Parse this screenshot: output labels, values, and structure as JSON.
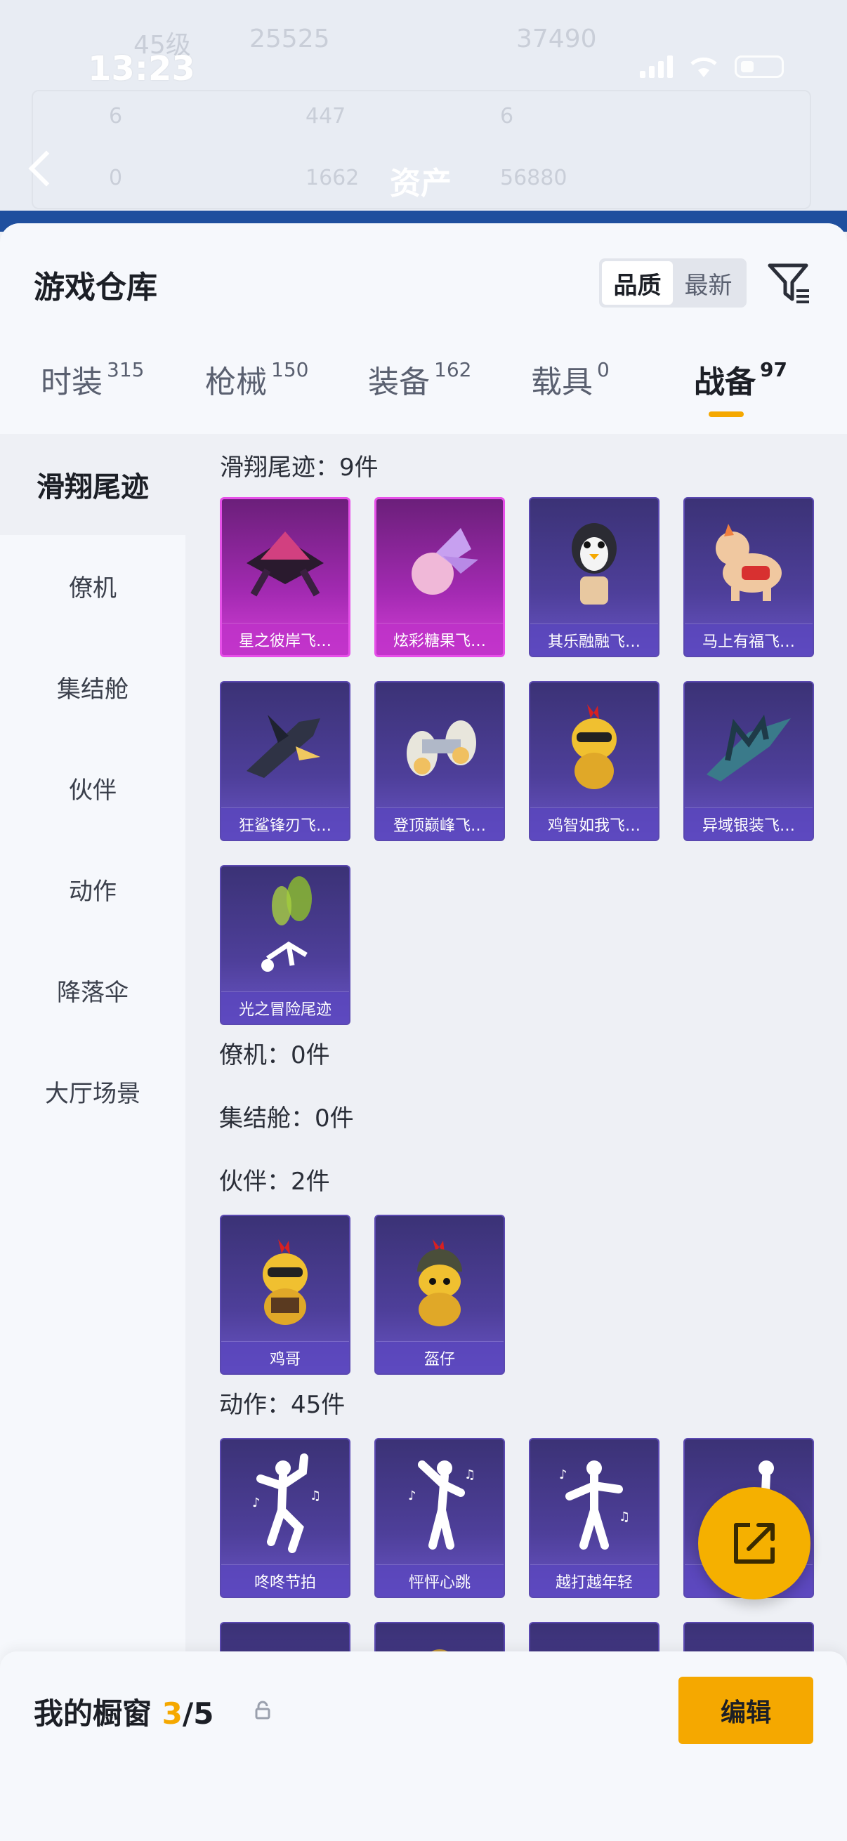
{
  "background": {
    "status_time": "13:23",
    "header_title": "资产",
    "ghost_level": "45级",
    "ghost_stats": [
      "25525",
      "37490",
      "6",
      "447",
      "6",
      "0",
      "1662",
      "56880"
    ]
  },
  "header": {
    "title": "游戏仓库",
    "sort_options": [
      "品质",
      "最新"
    ],
    "active_sort": "品质"
  },
  "tabs": [
    {
      "label": "时装",
      "count": "315"
    },
    {
      "label": "枪械",
      "count": "150"
    },
    {
      "label": "装备",
      "count": "162"
    },
    {
      "label": "载具",
      "count": "0"
    },
    {
      "label": "战备",
      "count": "97"
    }
  ],
  "sidebar": {
    "items": [
      "滑翔尾迹",
      "僚机",
      "集结舱",
      "伙伴",
      "动作",
      "降落伞",
      "大厅场景"
    ],
    "active": "滑翔尾迹"
  },
  "sections": {
    "glide": {
      "title": "滑翔尾迹：9件",
      "items": [
        "星之彼岸飞…",
        "炫彩糖果飞…",
        "其乐融融飞…",
        "马上有福飞…",
        "狂鲨锋刃飞…",
        "登顶巅峰飞…",
        "鸡智如我飞…",
        "异域银装飞…",
        "光之冒险尾迹"
      ]
    },
    "wingman": {
      "title": "僚机：0件"
    },
    "pod": {
      "title": "集结舱：0件"
    },
    "partner": {
      "title": "伙伴：2件",
      "items": [
        "鸡哥",
        "盔仔"
      ]
    },
    "emote": {
      "title": "动作：45件",
      "items": [
        "咚咚节拍",
        "怦怦心跳",
        "越打越年轻",
        ""
      ]
    }
  },
  "bottom_bar": {
    "title": "我的橱窗",
    "count_current": "3",
    "count_total": "/5",
    "edit_label": "编辑"
  },
  "colors": {
    "accent": "#f5a800",
    "rare_pink": "#d43fd6",
    "epic_purple": "#4e3f9a"
  }
}
